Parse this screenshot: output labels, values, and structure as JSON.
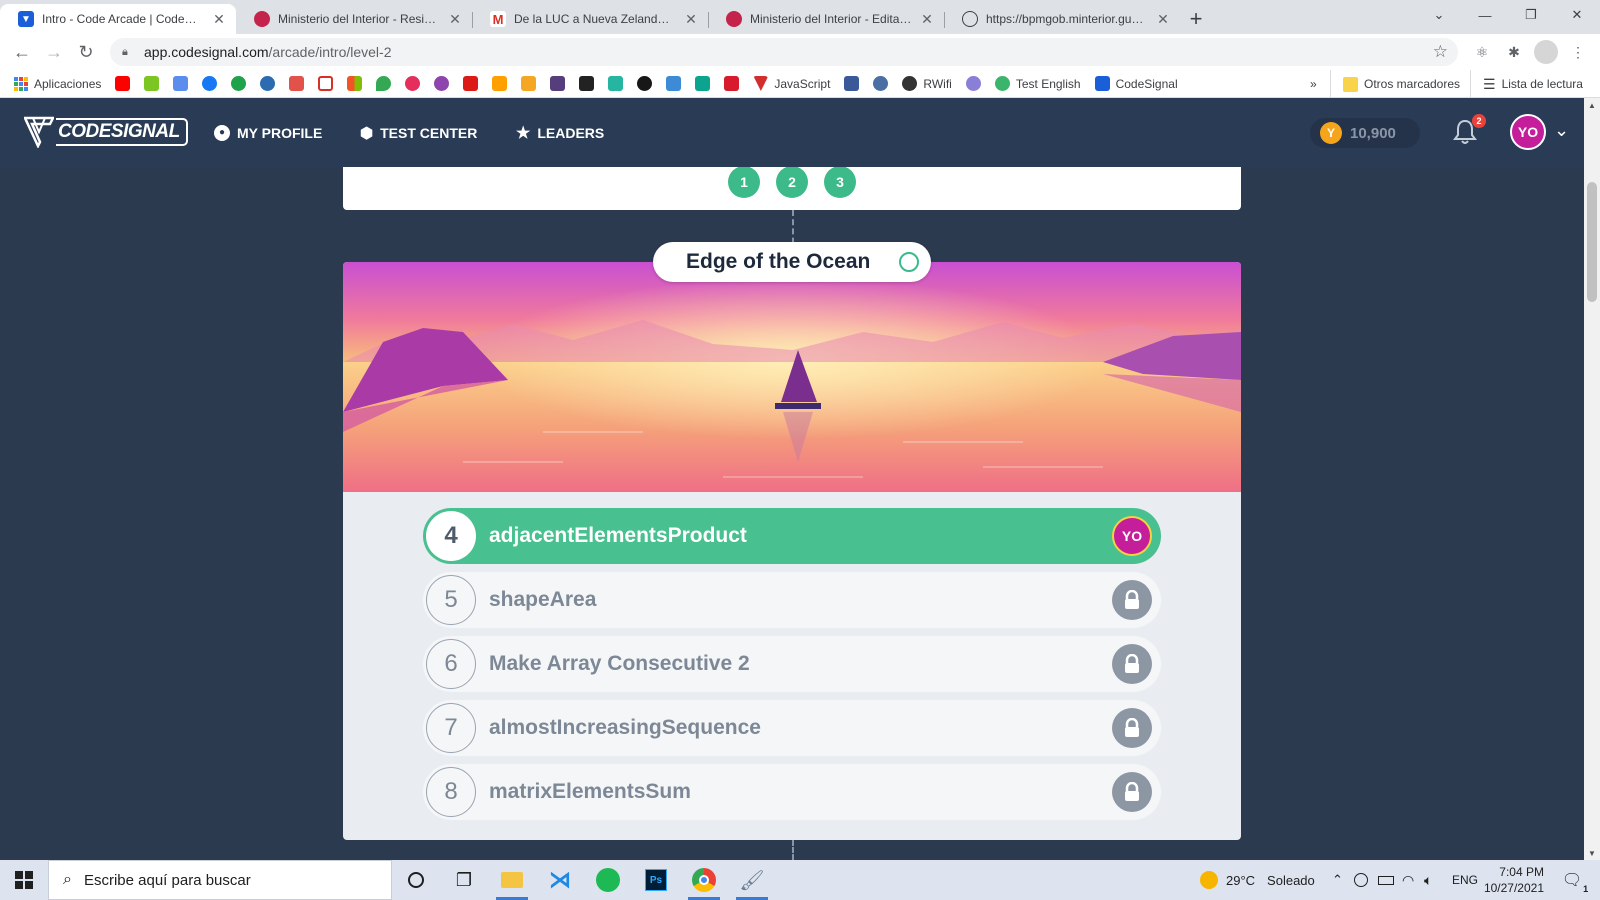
{
  "browser": {
    "tabs": [
      {
        "label": "Intro - Code Arcade | CodeSignal",
        "icon": "codesignal-icon",
        "active": true
      },
      {
        "label": "Ministerio del Interior - Residencia",
        "icon": "ministerio-icon",
        "active": false
      },
      {
        "label": "De la LUC a Nueva Zelanda - ykohan",
        "icon": "gmail-icon",
        "active": false
      },
      {
        "label": "Ministerio del Interior - Edita tu s",
        "icon": "ministerio-icon",
        "active": false
      },
      {
        "label": "https://bpmgob.minterior.gub.uy",
        "icon": "globe-icon",
        "active": false
      }
    ],
    "address": {
      "domain": "app.codesignal.com",
      "path": "/arcade/intro/level-2"
    },
    "bookmarks": {
      "apps_label": "Aplicaciones",
      "items": [
        "JavaScript",
        "RWifi",
        "Test English",
        "CodeSignal"
      ],
      "overflow": "»",
      "other": "Otros marcadores",
      "reading_list": "Lista de lectura"
    }
  },
  "header": {
    "logo": "CODESIGNAL",
    "nav": [
      {
        "label": "MY PROFILE",
        "icon": "profile-icon"
      },
      {
        "label": "TEST CENTER",
        "icon": "shield-icon"
      },
      {
        "label": "LEADERS",
        "icon": "star-icon"
      }
    ],
    "coins": "10,900",
    "notifications": "2",
    "avatar": "YO"
  },
  "arcade": {
    "levels": [
      "1",
      "2",
      "3"
    ],
    "section_title": "Edge of the Ocean",
    "tasks": [
      {
        "number": "4",
        "name": "adjacentElementsProduct",
        "status": "current",
        "badge": "YO"
      },
      {
        "number": "5",
        "name": "shapeArea",
        "status": "locked"
      },
      {
        "number": "6",
        "name": "Make Array Consecutive 2",
        "status": "locked"
      },
      {
        "number": "7",
        "name": "almostIncreasingSequence",
        "status": "locked"
      },
      {
        "number": "8",
        "name": "matrixElementsSum",
        "status": "locked"
      }
    ]
  },
  "taskbar": {
    "search_placeholder": "Escribe aquí para buscar",
    "weather_temp": "29°C",
    "weather_text": "Soleado",
    "language": "ENG",
    "time": "7:04 PM",
    "date": "10/27/2021",
    "notification_count": "1"
  },
  "colors": {
    "accent": "#48c08f",
    "header": "#2a3b55",
    "background": "#2c3a50",
    "avatar": "#c51e9b"
  }
}
